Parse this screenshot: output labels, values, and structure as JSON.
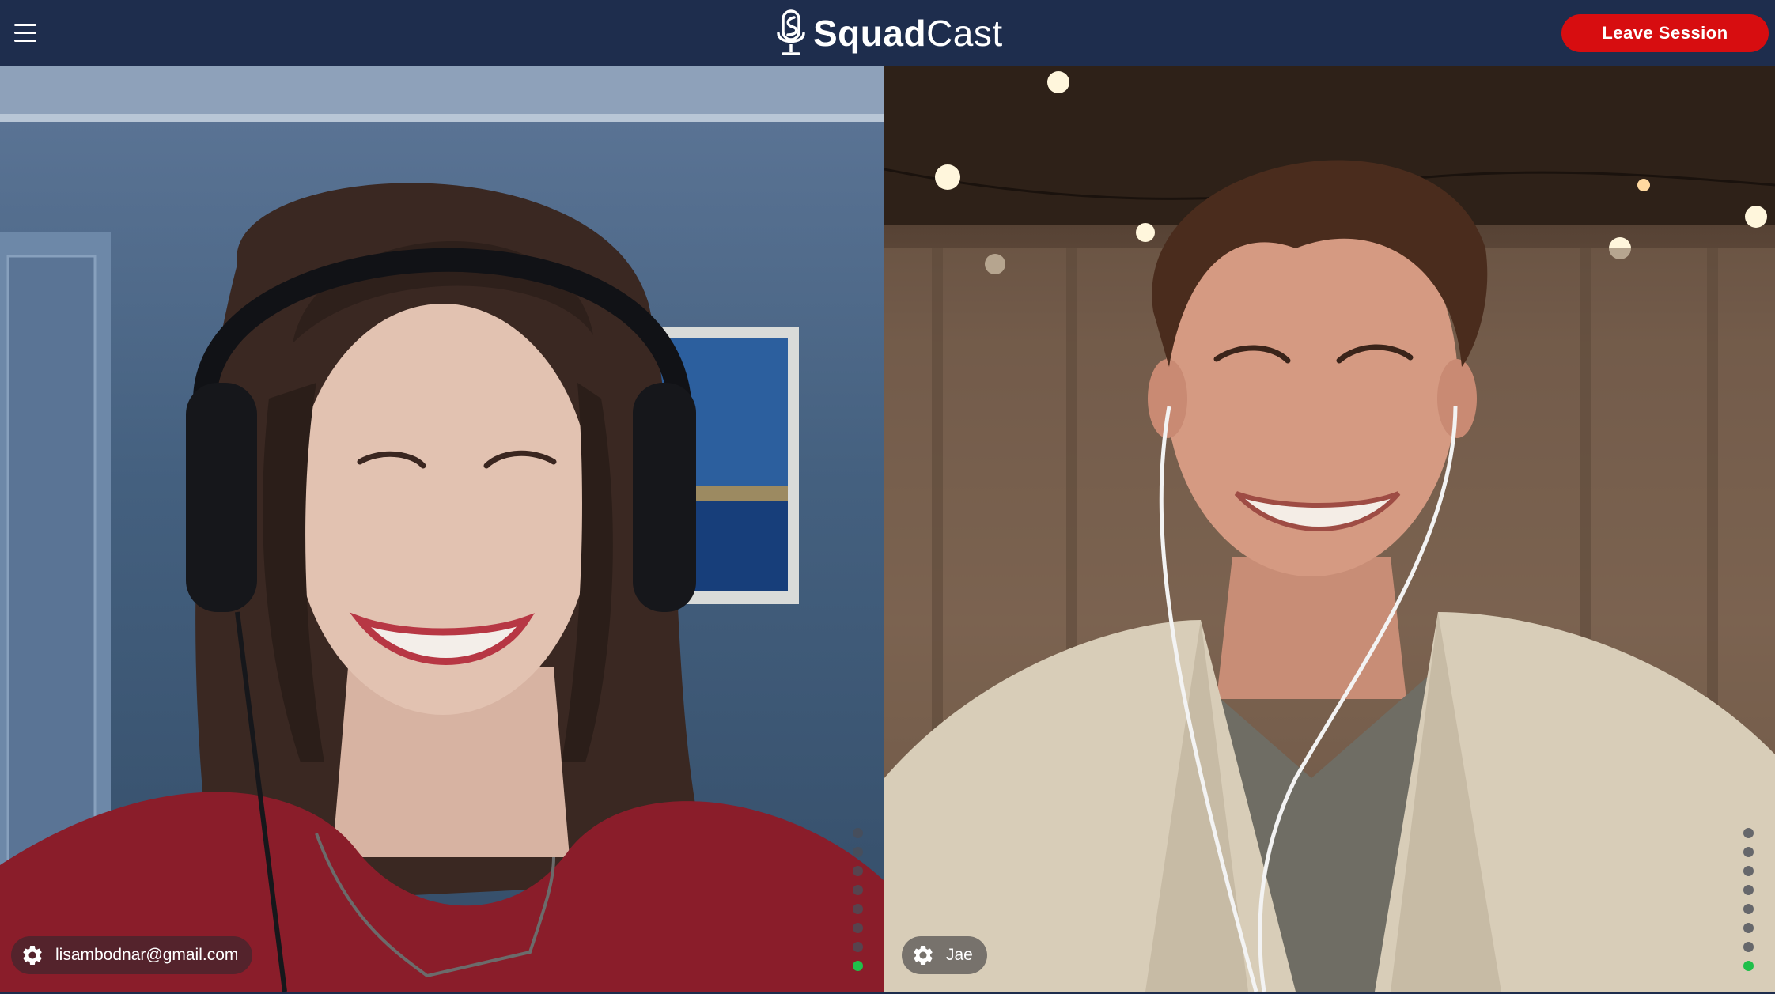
{
  "header": {
    "brand_bold": "Squad",
    "brand_light": "Cast",
    "leave_label": "Leave Session"
  },
  "participants": [
    {
      "name": "lisambodnar@gmail.com",
      "level_dots": 8,
      "level_active": 1
    },
    {
      "name": "Jae",
      "level_dots": 8,
      "level_active": 1
    }
  ],
  "colors": {
    "header_bg": "#1e2d4d",
    "leave_button": "#d70d10",
    "level_active": "#1fbf4a",
    "level_inactive": "#4a4e57"
  },
  "icons": {
    "menu": "hamburger-menu-icon",
    "logo": "microphone-logo-icon",
    "settings": "gear-icon"
  }
}
